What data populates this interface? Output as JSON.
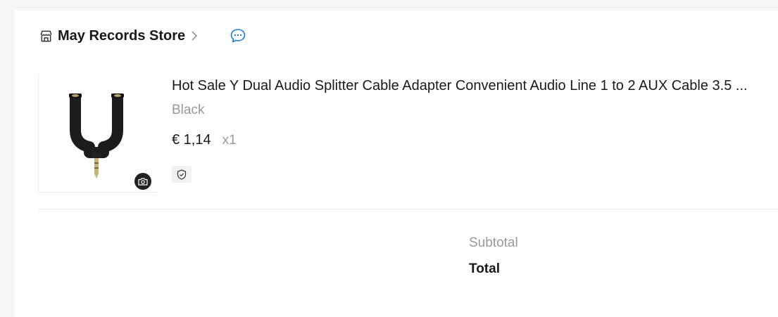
{
  "store": {
    "name": "May Records Store"
  },
  "item": {
    "title": "Hot Sale Y Dual Audio Splitter Cable Adapter Convenient Audio Line 1 to 2 AUX Cable 3.5 ...",
    "variant": "Black",
    "price": "€ 1,14",
    "quantity": "x1"
  },
  "summary": {
    "subtotal_label": "Subtotal",
    "total_label": "Total"
  },
  "icons": {
    "store": "store-icon",
    "chevron": "chevron-right-icon",
    "chat": "chat-icon",
    "camera": "camera-icon",
    "shield": "shield-check-icon"
  },
  "colors": {
    "chat_accent": "#1a7bd8",
    "muted_text": "#999999",
    "primary_text": "#191919"
  }
}
